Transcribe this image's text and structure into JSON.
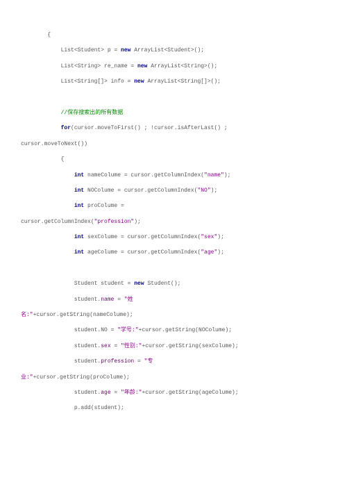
{
  "code": {
    "lines": [
      {
        "indent": "        ",
        "segments": [
          {
            "text": "{",
            "cls": ""
          }
        ]
      },
      {
        "indent": "            ",
        "segments": [
          {
            "text": "List<Student> p = ",
            "cls": ""
          },
          {
            "text": "new",
            "cls": "kw"
          },
          {
            "text": " ArrayList<Student>();",
            "cls": ""
          }
        ]
      },
      {
        "indent": "            ",
        "segments": [
          {
            "text": "List<String> re_name = ",
            "cls": ""
          },
          {
            "text": "new",
            "cls": "kw"
          },
          {
            "text": " ArrayList<String>();",
            "cls": ""
          }
        ]
      },
      {
        "indent": "            ",
        "segments": [
          {
            "text": "List<String[]> info = ",
            "cls": ""
          },
          {
            "text": "new",
            "cls": "kw"
          },
          {
            "text": " ArrayList<String[]>();",
            "cls": ""
          }
        ]
      },
      {
        "indent": "",
        "segments": [
          {
            "text": "",
            "cls": ""
          }
        ]
      },
      {
        "indent": "            ",
        "segments": [
          {
            "text": "//保存搜索出的所有数据",
            "cls": "comment"
          }
        ]
      },
      {
        "indent": "            ",
        "segments": [
          {
            "text": "for",
            "cls": "kw"
          },
          {
            "text": "(cursor.moveToFirst() ; !cursor.isAfterLast() ; ",
            "cls": ""
          }
        ]
      },
      {
        "indent": "",
        "segments": [
          {
            "text": "cursor.moveToNext())",
            "cls": ""
          }
        ]
      },
      {
        "indent": "            ",
        "segments": [
          {
            "text": "{",
            "cls": ""
          }
        ]
      },
      {
        "indent": "                ",
        "segments": [
          {
            "text": "int",
            "cls": "kw"
          },
          {
            "text": " nameColume = cursor.getColumnIndex(",
            "cls": ""
          },
          {
            "text": "\"name\"",
            "cls": "str"
          },
          {
            "text": ");",
            "cls": ""
          }
        ]
      },
      {
        "indent": "                ",
        "segments": [
          {
            "text": "int",
            "cls": "kw"
          },
          {
            "text": " NOColume = cursor.getColumnIndex(",
            "cls": ""
          },
          {
            "text": "\"NO\"",
            "cls": "str"
          },
          {
            "text": ");",
            "cls": ""
          }
        ]
      },
      {
        "indent": "                ",
        "segments": [
          {
            "text": "int",
            "cls": "kw"
          },
          {
            "text": " proColume = ",
            "cls": ""
          }
        ]
      },
      {
        "indent": "",
        "segments": [
          {
            "text": "cursor.getColumnIndex(",
            "cls": ""
          },
          {
            "text": "\"profession\"",
            "cls": "str"
          },
          {
            "text": ");",
            "cls": ""
          }
        ]
      },
      {
        "indent": "                ",
        "segments": [
          {
            "text": "int",
            "cls": "kw"
          },
          {
            "text": " sexColume = cursor.getColumnIndex(",
            "cls": ""
          },
          {
            "text": "\"sex\"",
            "cls": "str"
          },
          {
            "text": ");",
            "cls": ""
          }
        ]
      },
      {
        "indent": "                ",
        "segments": [
          {
            "text": "int",
            "cls": "kw"
          },
          {
            "text": " ageColume = cursor.getColumnIndex(",
            "cls": ""
          },
          {
            "text": "\"age\"",
            "cls": "str"
          },
          {
            "text": ");",
            "cls": ""
          }
        ]
      },
      {
        "indent": "",
        "segments": [
          {
            "text": "",
            "cls": ""
          }
        ]
      },
      {
        "indent": "                ",
        "segments": [
          {
            "text": "Student student = ",
            "cls": ""
          },
          {
            "text": "new",
            "cls": "kw"
          },
          {
            "text": " Student();",
            "cls": ""
          }
        ]
      },
      {
        "indent": "                ",
        "segments": [
          {
            "text": "student.",
            "cls": ""
          },
          {
            "text": "name",
            "cls": "field"
          },
          {
            "text": " = ",
            "cls": ""
          },
          {
            "text": "\"姓",
            "cls": "str"
          }
        ]
      },
      {
        "indent": "",
        "segments": [
          {
            "text": "名:\"",
            "cls": "str"
          },
          {
            "text": "+cursor.getString(nameColume);",
            "cls": ""
          }
        ]
      },
      {
        "indent": "                ",
        "segments": [
          {
            "text": "student.",
            "cls": ""
          },
          {
            "text": "NO",
            "cls": ""
          },
          {
            "text": " = ",
            "cls": ""
          },
          {
            "text": "\"学号:\"",
            "cls": "str"
          },
          {
            "text": "+cursor.getString(NOColume);",
            "cls": ""
          }
        ]
      },
      {
        "indent": "                ",
        "segments": [
          {
            "text": "student.",
            "cls": ""
          },
          {
            "text": "sex",
            "cls": "field"
          },
          {
            "text": " = ",
            "cls": ""
          },
          {
            "text": "\"性别:\"",
            "cls": "str"
          },
          {
            "text": "+cursor.getString(sexColume);",
            "cls": ""
          }
        ]
      },
      {
        "indent": "                ",
        "segments": [
          {
            "text": "student.",
            "cls": ""
          },
          {
            "text": "profession",
            "cls": "field"
          },
          {
            "text": " = ",
            "cls": ""
          },
          {
            "text": "\"专",
            "cls": "str"
          }
        ]
      },
      {
        "indent": "",
        "segments": [
          {
            "text": "业:\"",
            "cls": "str"
          },
          {
            "text": "+cursor.getString(proColume);",
            "cls": ""
          }
        ]
      },
      {
        "indent": "                ",
        "segments": [
          {
            "text": "student.",
            "cls": ""
          },
          {
            "text": "age",
            "cls": "field"
          },
          {
            "text": " = ",
            "cls": ""
          },
          {
            "text": "\"年龄:\"",
            "cls": "str"
          },
          {
            "text": "+cursor.getString(ageColume);",
            "cls": ""
          }
        ]
      },
      {
        "indent": "                ",
        "segments": [
          {
            "text": "p.add(student);",
            "cls": ""
          }
        ]
      }
    ]
  }
}
